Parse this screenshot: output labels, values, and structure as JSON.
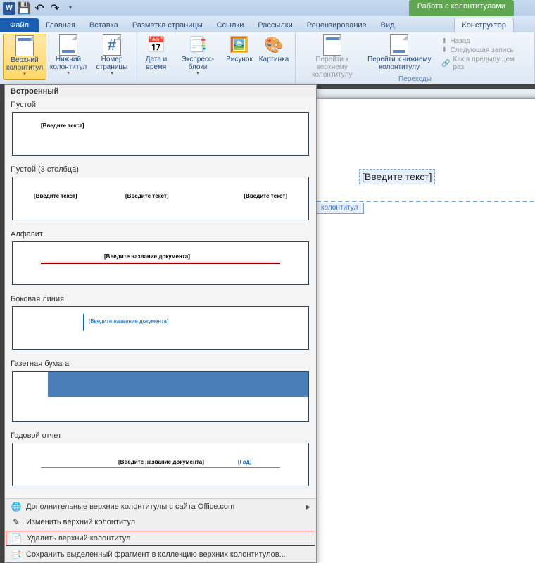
{
  "qat": {
    "word": "W"
  },
  "context_header": "Работа с колонтитулами",
  "tabs": {
    "file": "Файл",
    "items": [
      "Главная",
      "Вставка",
      "Разметка страницы",
      "Ссылки",
      "Рассылки",
      "Рецензирование",
      "Вид"
    ],
    "context": "Конструктор"
  },
  "ribbon": {
    "header_btn": "Верхний колонтитул",
    "footer_btn": "Нижний колонтитул",
    "pagenum_btn": "Номер страницы",
    "datetime_btn": "Дата и время",
    "quickparts_btn": "Экспресс-блоки",
    "picture_btn": "Рисунок",
    "clipart_btn": "Картинка",
    "goto_header": "Перейти к верхнему колонтитулу",
    "goto_footer": "Перейти к нижнему колонтитулу",
    "nav_back": "Назад",
    "nav_next": "Следующая запись",
    "nav_prev": "Как в предыдущем раз",
    "group_nav": "Переходы"
  },
  "gallery": {
    "section_builtin": "Встроенный",
    "items": [
      {
        "label": "Пустой",
        "placeholder": "[Введите текст]"
      },
      {
        "label": "Пустой (3 столбца)",
        "placeholder": "[Введите текст]"
      },
      {
        "label": "Алфавит",
        "placeholder": "[Введите название документа]"
      },
      {
        "label": "Боковая линия",
        "placeholder": "[Введите название документа]"
      },
      {
        "label": "Газетная бумага",
        "placeholder": ""
      },
      {
        "label": "Годовой отчет",
        "placeholder": "[Введите название документа]",
        "extra": "[Год]"
      }
    ],
    "menu_more": "Дополнительные верхние колонтитулы с сайта Office.com",
    "menu_edit": "Изменить верхний колонтитул",
    "menu_remove": "Удалить верхний колонтитул",
    "menu_save": "Сохранить выделенный фрагмент в коллекцию верхних колонтитулов..."
  },
  "page": {
    "placeholder": "[Введите текст]",
    "hf_tab": "колонтитул"
  }
}
